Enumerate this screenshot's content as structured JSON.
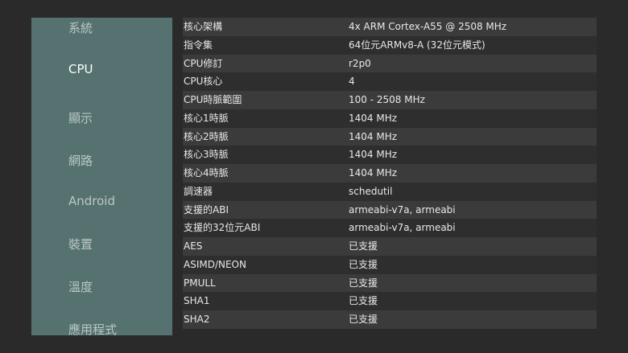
{
  "sidebar": {
    "items": [
      {
        "label": "系統"
      },
      {
        "label": "CPU",
        "selected": true
      },
      {
        "label": "顯示"
      },
      {
        "label": "網路"
      },
      {
        "label": "Android"
      },
      {
        "label": "裝置"
      },
      {
        "label": "溫度"
      },
      {
        "label": "應用程式"
      }
    ]
  },
  "rows": [
    {
      "label": "核心架構",
      "value": "4x ARM Cortex-A55 @ 2508 MHz"
    },
    {
      "label": "指令集",
      "value": "64位元ARMv8-A (32位元模式)"
    },
    {
      "label": "CPU修訂",
      "value": "r2p0"
    },
    {
      "label": "CPU核心",
      "value": "4"
    },
    {
      "label": "CPU時脈範圍",
      "value": "100 - 2508 MHz"
    },
    {
      "label": "核心1時脈",
      "value": "1404 MHz"
    },
    {
      "label": "核心2時脈",
      "value": "1404 MHz"
    },
    {
      "label": "核心3時脈",
      "value": "1404 MHz"
    },
    {
      "label": "核心4時脈",
      "value": "1404 MHz"
    },
    {
      "label": "調速器",
      "value": "schedutil"
    },
    {
      "label": "支援的ABI",
      "value": "armeabi-v7a, armeabi"
    },
    {
      "label": "支援的32位元ABI",
      "value": "armeabi-v7a, armeabi"
    },
    {
      "label": "AES",
      "value": "已支援"
    },
    {
      "label": "ASIMD/NEON",
      "value": "已支援"
    },
    {
      "label": "PMULL",
      "value": "已支援"
    },
    {
      "label": "SHA1",
      "value": "已支援"
    },
    {
      "label": "SHA2",
      "value": "已支援"
    }
  ],
  "colors": {
    "background": "#2a2a2a",
    "sidebar": "#567270",
    "row_odd": "#3b3b3b",
    "row_even": "#2e2e2e",
    "text": "#e8e8e8",
    "nav_text": "#b9c8c6",
    "nav_selected_text": "#ffffff"
  }
}
